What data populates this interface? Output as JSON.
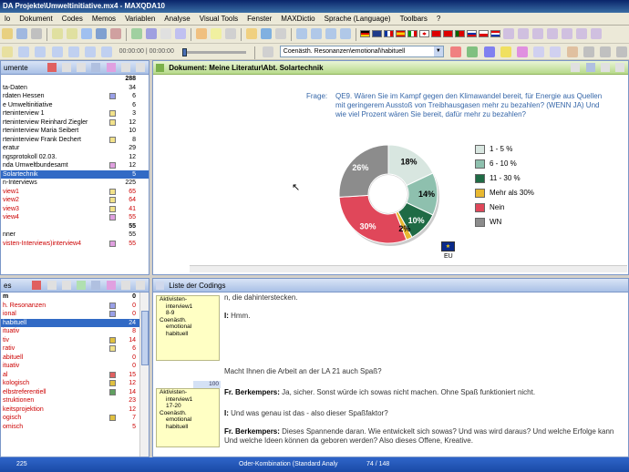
{
  "window": {
    "title": "DA Projekte\\Umweltinitiative.mx4 - MAXQDA10"
  },
  "menu": [
    "lo",
    "Dokument",
    "Codes",
    "Memos",
    "Variablen",
    "Analyse",
    "Visual Tools",
    "Fenster",
    "MAXDictio",
    "Sprache (Language)",
    "Toolbars",
    "?"
  ],
  "toolbar": {
    "time": "00:00:00 | 00:00:00",
    "code_selector": "Coenästh. Resonanzen\\emotional\\habituell"
  },
  "doc_panel": {
    "title": "umente",
    "rows": [
      {
        "label": "",
        "num": "288",
        "style": "bold",
        "icon": ""
      },
      {
        "label": "ta-Daten",
        "num": "34",
        "style": "",
        "icon": ""
      },
      {
        "label": "rdaten Hessen",
        "num": "6",
        "style": "",
        "icon": "#9aa0e8"
      },
      {
        "label": "e Umweltinitiative",
        "num": "6",
        "style": "",
        "icon": ""
      },
      {
        "label": "rteninterview 1",
        "num": "3",
        "style": "",
        "icon": "#f2e28a"
      },
      {
        "label": "rteninterview Reinhard Ziegler",
        "num": "12",
        "style": "",
        "icon": "#f2e28a"
      },
      {
        "label": "rteninterview Maria Seibert",
        "num": "10",
        "style": "",
        "icon": ""
      },
      {
        "label": "rteninterview Frank Dechert",
        "num": "8",
        "style": "",
        "icon": "#f2e28a"
      },
      {
        "label": "eratur",
        "num": "29",
        "style": "",
        "icon": ""
      },
      {
        "label": "ngsprotokoll 02.03.",
        "num": "12",
        "style": "",
        "icon": ""
      },
      {
        "label": "nda Umweltbundesamt",
        "num": "12",
        "style": "",
        "icon": "#e0a0e0"
      },
      {
        "label": "Solartechnik",
        "num": "5",
        "style": "sel",
        "icon": ""
      },
      {
        "label": "n-Interviews",
        "num": "225",
        "style": "",
        "icon": ""
      },
      {
        "label": "view1",
        "num": "65",
        "style": "red",
        "icon": "#f2e28a"
      },
      {
        "label": "view2",
        "num": "64",
        "style": "red",
        "icon": "#f2e28a"
      },
      {
        "label": "view3",
        "num": "41",
        "style": "red",
        "icon": "#f2e28a"
      },
      {
        "label": "view4",
        "num": "55",
        "style": "red",
        "icon": "#e0a0e0"
      },
      {
        "label": "",
        "num": "55",
        "style": "bold",
        "icon": ""
      },
      {
        "label": "nner",
        "num": "55",
        "style": "",
        "icon": ""
      },
      {
        "label": "visten-Interviews)interview4",
        "num": "55",
        "style": "red",
        "icon": "#e0a0e0"
      }
    ]
  },
  "code_panel": {
    "title": "es",
    "rows": [
      {
        "label": "m",
        "num": "0",
        "style": "bold",
        "color": ""
      },
      {
        "label": "h. Resonanzen",
        "num": "0",
        "style": "red",
        "color": "#9aa0e8"
      },
      {
        "label": "ional",
        "num": "0",
        "style": "red",
        "color": "#9aa0e8"
      },
      {
        "label": "habituell",
        "num": "24",
        "style": "sel",
        "color": ""
      },
      {
        "label": "ituativ",
        "num": "8",
        "style": "red",
        "color": ""
      },
      {
        "label": "tiv",
        "num": "14",
        "style": "red",
        "color": "#e0c040"
      },
      {
        "label": "rativ",
        "num": "6",
        "style": "red",
        "color": "#f2e28a"
      },
      {
        "label": "abituell",
        "num": "0",
        "style": "red",
        "color": ""
      },
      {
        "label": "ituativ",
        "num": "0",
        "style": "red",
        "color": ""
      },
      {
        "label": "al",
        "num": "15",
        "style": "red",
        "color": "#e06060"
      },
      {
        "label": "kologisch",
        "num": "12",
        "style": "red",
        "color": "#e0c040"
      },
      {
        "label": "elbstreferentiell",
        "num": "14",
        "style": "red",
        "color": "#60a060"
      },
      {
        "label": "struktionen",
        "num": "23",
        "style": "red",
        "color": ""
      },
      {
        "label": "keitsprojektion",
        "num": "12",
        "style": "red",
        "color": ""
      },
      {
        "label": "ogisch",
        "num": "7",
        "style": "red",
        "color": "#e0c040"
      },
      {
        "label": "omisch",
        "num": "5",
        "style": "red",
        "color": ""
      }
    ]
  },
  "doc_view": {
    "title": "Dokument: Meine Literatur\\Abt. Solartechnik",
    "question_label": "Frage:",
    "question": "QE9. Wären Sie im Kampf gegen den Klimawandel bereit, für Energie aus Quellen mit geringerem Ausstoß von Treibhausgasen mehr zu bezahlen? (WENN JA) Und wie viel Prozent wären Sie bereit, dafür mehr zu bezahlen?",
    "eu_label": "EU"
  },
  "chart_data": {
    "type": "pie",
    "title": "",
    "slices": [
      {
        "label": "1 - 5 %",
        "value": 18,
        "color": "#d8e6e0",
        "display": "18%"
      },
      {
        "label": "6 - 10 %",
        "value": 14,
        "color": "#8ec0ae",
        "display": "14%"
      },
      {
        "label": "11 - 30 %",
        "value": 10,
        "color": "#1f6b45",
        "display": "10%"
      },
      {
        "label": "Mehr als 30%",
        "value": 2,
        "color": "#e8b830",
        "display": "2%"
      },
      {
        "label": "Nein",
        "value": 30,
        "color": "#e0475a",
        "display": "30%"
      },
      {
        "label": "WN",
        "value": 26,
        "color": "#8c8c8c",
        "display": "26%"
      }
    ],
    "legend_position": "right"
  },
  "codings_panel": {
    "title": "Liste der Codings",
    "margin1": [
      "Aktivisten-",
      "interview1",
      "8-9",
      "Coenästh.",
      "emotional",
      "habituell"
    ],
    "margin2": [
      "Aktivisten-",
      "interview1",
      "17-20",
      "Coenästh.",
      "emotional",
      "habituell"
    ],
    "margin_number": "100",
    "paragraphs": [
      {
        "speaker": "",
        "text": "n, die dahinterstecken."
      },
      {
        "speaker": "I:",
        "text": " Hmm."
      },
      {
        "speaker": "",
        "text": "Macht Ihnen die Arbeit an der LA 21 auch Spaß?"
      },
      {
        "speaker": "Fr. Berkempers:",
        "text": " Ja, sicher. Sonst würde ich sowas nicht machen. Ohne Spaß funktioniert nicht."
      },
      {
        "speaker": "I:",
        "text": " Und was genau ist das - also dieser Spaßfaktor?"
      },
      {
        "speaker": "Fr. Berkempers:",
        "text": " Dieses Spannende daran. Wie entwickelt sich sowas? Und was wird daraus? Und welche Erfolge kann"
      },
      {
        "speaker": "",
        "text": "Und welche Ideen können da geboren werden? Also dieses Offene, Kreative."
      }
    ]
  },
  "status": {
    "count": "225",
    "mode": "Oder-Kombination (Standard Analy",
    "pages": "74 / 148"
  }
}
